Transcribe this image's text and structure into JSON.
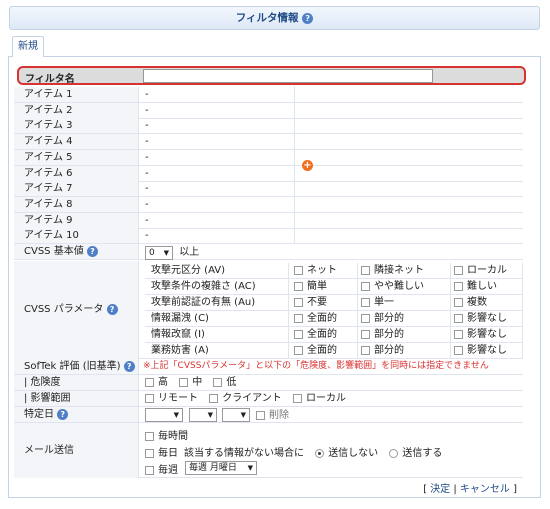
{
  "title": "フィルタ情報",
  "tab": "新規",
  "filter_name": {
    "label": "フィルタ名",
    "value": ""
  },
  "items": [
    {
      "label": "アイテム 1",
      "value": "-"
    },
    {
      "label": "アイテム 2",
      "value": "-"
    },
    {
      "label": "アイテム 3",
      "value": "-"
    },
    {
      "label": "アイテム 4",
      "value": "-"
    },
    {
      "label": "アイテム 5",
      "value": "-"
    },
    {
      "label": "アイテム 6",
      "value": "-"
    },
    {
      "label": "アイテム 7",
      "value": "-"
    },
    {
      "label": "アイテム 8",
      "value": "-"
    },
    {
      "label": "アイテム 9",
      "value": "-"
    },
    {
      "label": "アイテム 10",
      "value": "-"
    }
  ],
  "cvss_base": {
    "label": "CVSS 基本値",
    "value": "0",
    "suffix": "以上"
  },
  "cvss_params": {
    "label": "CVSS パラメータ",
    "rows": [
      {
        "q": "攻撃元区分 (AV)",
        "opts": [
          "ネット",
          "隣接ネット",
          "ローカル"
        ]
      },
      {
        "q": "攻撃条件の複雑さ (AC)",
        "opts": [
          "簡単",
          "やや難しい",
          "難しい"
        ]
      },
      {
        "q": "攻撃前認証の有無 (Au)",
        "opts": [
          "不要",
          "単一",
          "複数"
        ]
      },
      {
        "q": "情報漏洩 (C)",
        "opts": [
          "全面的",
          "部分的",
          "影響なし"
        ]
      },
      {
        "q": "情報改竄 (I)",
        "opts": [
          "全面的",
          "部分的",
          "影響なし"
        ]
      },
      {
        "q": "業務妨害 (A)",
        "opts": [
          "全面的",
          "部分的",
          "影響なし"
        ]
      }
    ]
  },
  "softek": {
    "label": "SofTek 評価 (旧基準)",
    "note": "※上記「CVSSパラメータ」と以下の「危険度、影響範囲」を同時には指定できません"
  },
  "danger": {
    "label": "| 危険度",
    "opts": [
      "高",
      "中",
      "低"
    ]
  },
  "scope": {
    "label": "| 影響範囲",
    "opts": [
      "リモート",
      "クライアント",
      "ローカル"
    ]
  },
  "date": {
    "label": "特定日",
    "delete": "削除"
  },
  "mail": {
    "label": "メール送信",
    "hourly": "毎時間",
    "daily": "毎日",
    "daily_cond": "該当する情報がない場合に",
    "no_send": "送信しない",
    "send": "送信する",
    "weekly": "毎週",
    "weekly_sel": "毎週 月曜日"
  },
  "footer": {
    "ok": "決定",
    "cancel": "キャンセル",
    "sep": "|",
    "lb": "[",
    "rb": "]"
  }
}
